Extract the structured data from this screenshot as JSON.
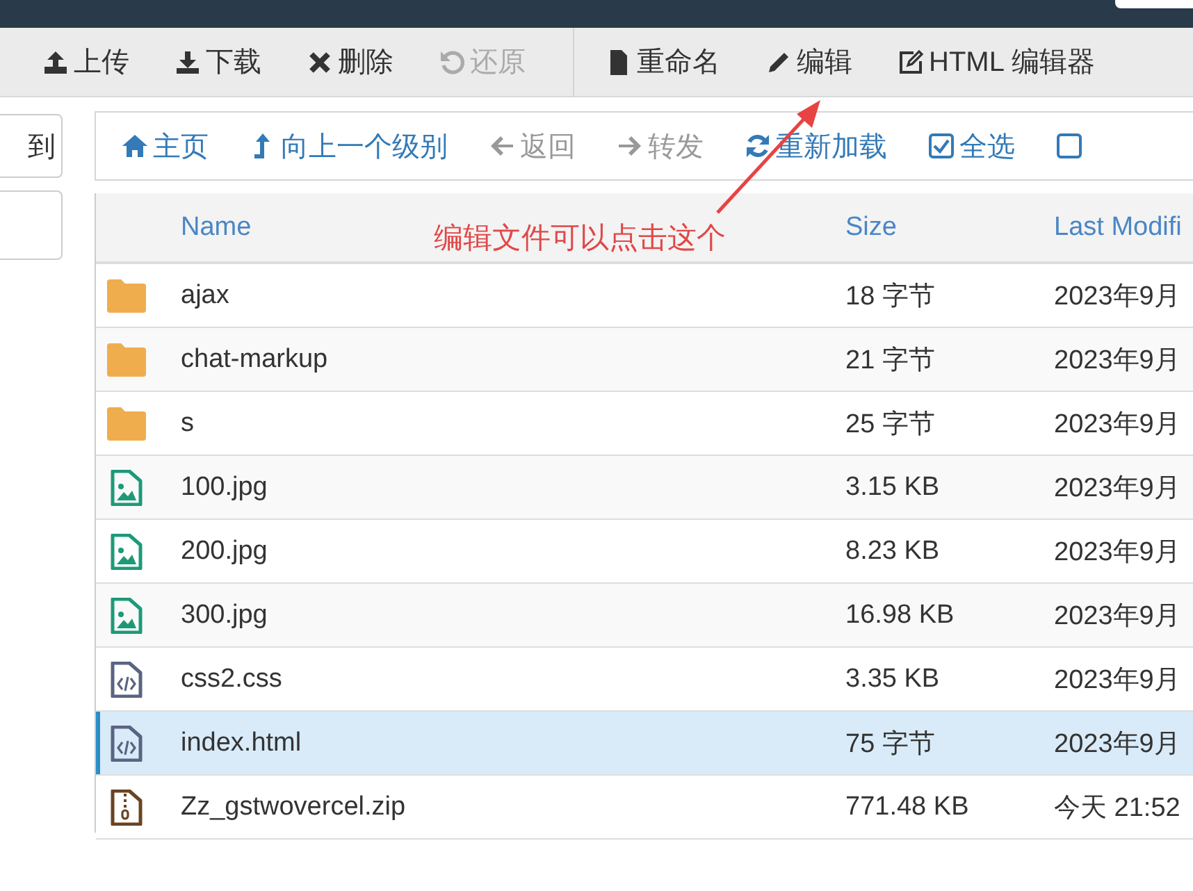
{
  "toolbar": [
    {
      "label": "上传",
      "disabled": false
    },
    {
      "label": "下载",
      "disabled": false
    },
    {
      "label": "删除",
      "disabled": false
    },
    {
      "label": "还原",
      "disabled": true
    },
    {
      "label": "重命名",
      "disabled": false
    },
    {
      "label": "编辑",
      "disabled": false
    },
    {
      "label": "HTML 编辑器",
      "disabled": false
    }
  ],
  "sidebar": {
    "goto_button": "到"
  },
  "nav": [
    {
      "label": "主页",
      "disabled": false
    },
    {
      "label": "向上一个级别",
      "disabled": false
    },
    {
      "label": "返回",
      "disabled": true
    },
    {
      "label": "转发",
      "disabled": true
    },
    {
      "label": "重新加载",
      "disabled": false
    },
    {
      "label": "全选",
      "disabled": false
    },
    {
      "disabled": false
    }
  ],
  "table": {
    "columns": [
      "Name",
      "Size",
      "Last Modifi"
    ],
    "rows": [
      {
        "kind": "folder",
        "name": "ajax",
        "size": "18 字节",
        "modified": "2023年9月",
        "selected": false
      },
      {
        "kind": "folder",
        "name": "chat-markup",
        "size": "21 字节",
        "modified": "2023年9月",
        "selected": false
      },
      {
        "kind": "folder",
        "name": "s",
        "size": "25 字节",
        "modified": "2023年9月",
        "selected": false
      },
      {
        "kind": "image",
        "name": "100.jpg",
        "size": "3.15 KB",
        "modified": "2023年9月",
        "selected": false
      },
      {
        "kind": "image",
        "name": "200.jpg",
        "size": "8.23 KB",
        "modified": "2023年9月",
        "selected": false
      },
      {
        "kind": "image",
        "name": "300.jpg",
        "size": "16.98 KB",
        "modified": "2023年9月",
        "selected": false
      },
      {
        "kind": "code",
        "name": "css2.css",
        "size": "3.35 KB",
        "modified": "2023年9月",
        "selected": false
      },
      {
        "kind": "code",
        "name": "index.html",
        "size": "75 字节",
        "modified": "2023年9月",
        "selected": true
      },
      {
        "kind": "zip",
        "name": "Zz_gstwovercel.zip",
        "size": "771.48 KB",
        "modified": "今天 21:52",
        "selected": false
      }
    ]
  },
  "annotation": {
    "text": "编辑文件可以点击这个"
  }
}
